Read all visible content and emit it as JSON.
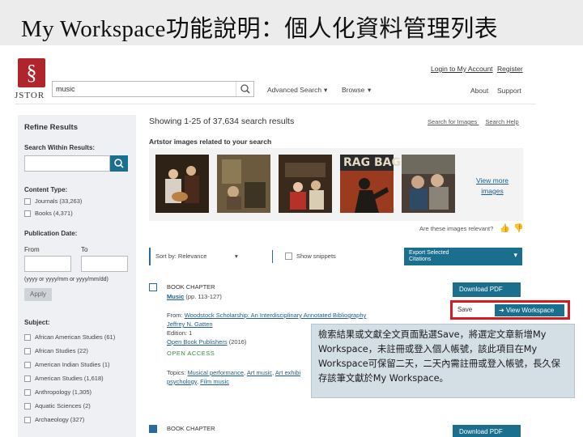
{
  "slide": {
    "title": "My Workspace功能說明：個人化資料管理列表"
  },
  "header": {
    "logo_text": "JSTOR",
    "search_value": "music",
    "advanced_search": "Advanced Search",
    "browse": "Browse",
    "login": "Login to My Account",
    "register": "Register",
    "about": "About",
    "support": "Support"
  },
  "refine": {
    "title": "Refine Results",
    "search_within": "Search Within Results:",
    "content_type": "Content Type:",
    "content_items": [
      "Journals (33,263)",
      "Books (4,371)"
    ],
    "pub_date": "Publication Date:",
    "from": "From",
    "to": "To",
    "date_hint": "(yyyy or yyyy/mm or yyyy/mm/dd)",
    "apply": "Apply",
    "subject": "Subject:",
    "subjects": [
      "African American Studies (61)",
      "African Studies (22)",
      "American Indian Studies (1)",
      "American Studies (1,618)",
      "Anthropology (1,305)",
      "Aquatic Sciences (2)",
      "Archaeology (327)"
    ]
  },
  "results": {
    "showing": "Showing 1-25 of 37,634 search results",
    "search_images": "Search for Images",
    "search_help": "Search Help",
    "artstor": "Artstor images related to your search",
    "thumb3_text": "RAG BAG",
    "view_more": "View more",
    "images": "images",
    "relevant": "Are these images relevant?",
    "sort": "Sort by: Relevance",
    "snippets": "Show snippets",
    "export_line1": "Export Selected",
    "export_line2": "Citations",
    "item1": {
      "kind": "BOOK CHAPTER",
      "title": "Music",
      "pages": "(pp. 113-127)",
      "from_label": "From:",
      "from_link": "Woodstock Scholarship: An Interdisciplinary Annotated Bibliography",
      "author": "Jeffrey N. Gatten",
      "edition": "Edition: 1",
      "publisher": "Open Book Publishers",
      "year": "(2016)",
      "open_access": "OPEN ACCESS",
      "topics_label": "Topics:",
      "topic1": "Musical performance",
      "topic2": "Art music",
      "topic3": "Art exhibi",
      "topic4": "psychology",
      "topic5": "Film music",
      "download": "Download PDF",
      "save": "Save",
      "view_workspace": "View Workspace"
    },
    "item2": {
      "kind": "BOOK CHAPTER",
      "download": "Download PDF"
    }
  },
  "callout": {
    "text": "檢索結果或文獻全文頁面點選Save，將選定文章新增My Workspace，未註冊或登入個人帳號，該此項目在My Workspace可保留二天，二天內需註冊或登入帳號，長久保存該筆文獻於My Workspace。"
  },
  "colors": {
    "accent": "#1a6f8f",
    "highlight": "#d71920",
    "logo": "#b0252c",
    "callout_bg": "#d4dee5"
  }
}
